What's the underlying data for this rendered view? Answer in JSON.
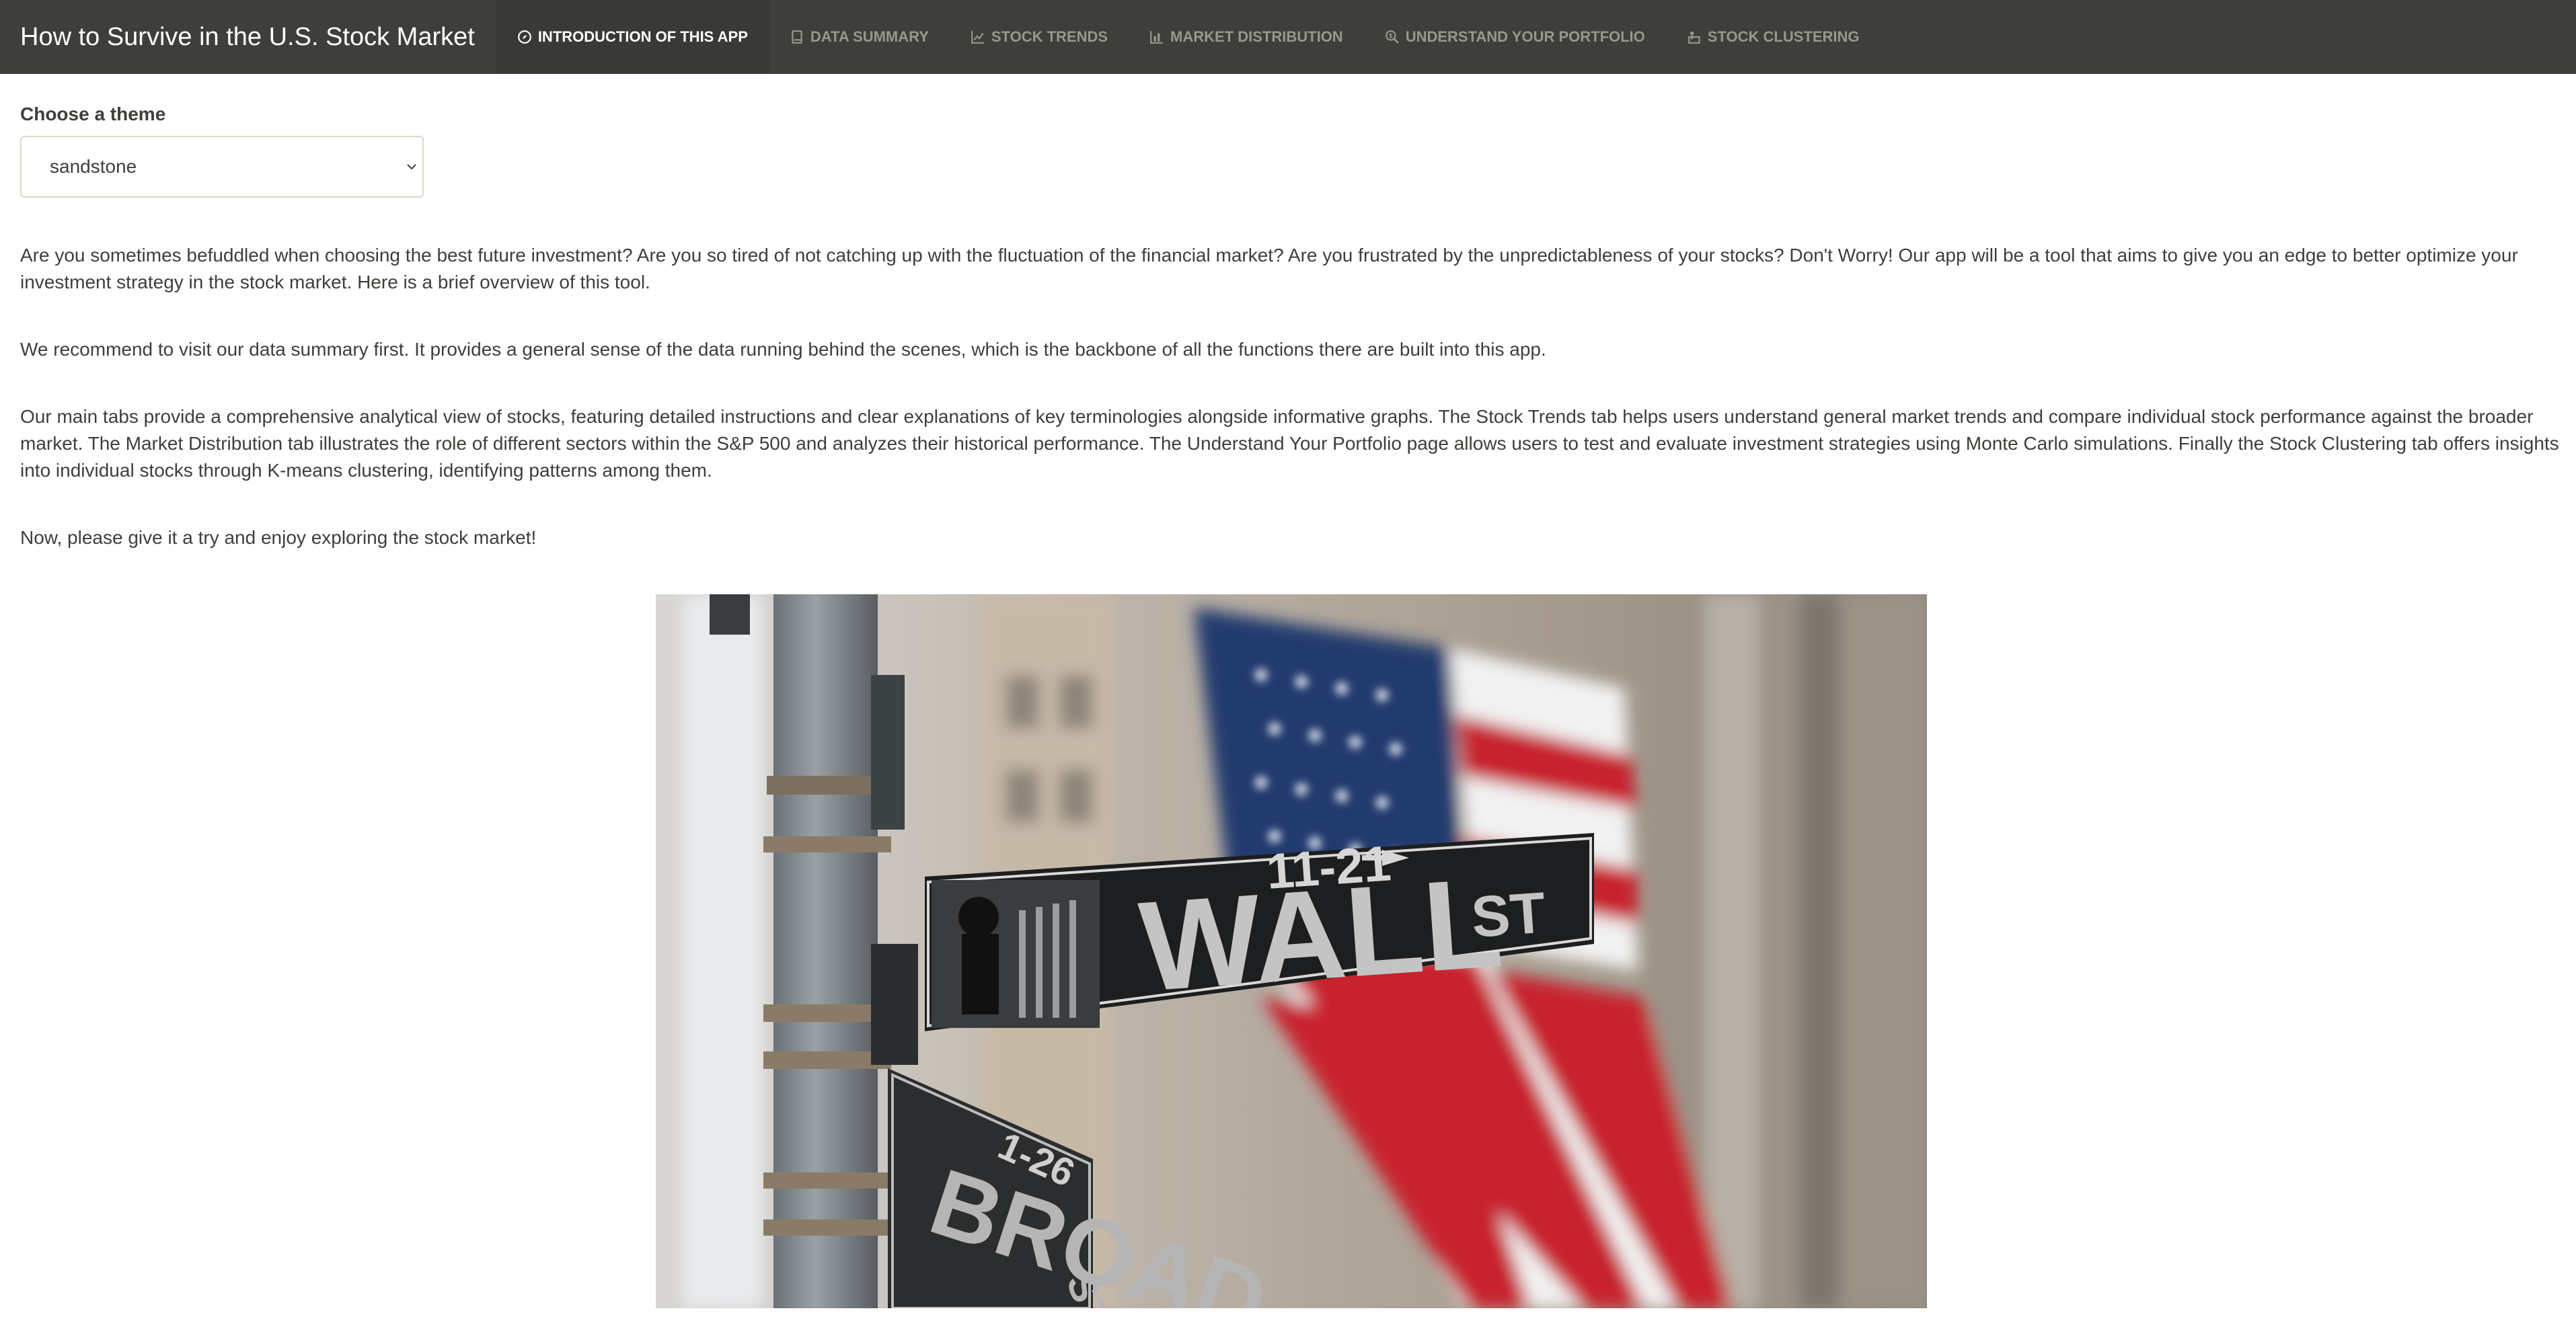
{
  "app": {
    "title": "How to Survive in the U.S. Stock Market"
  },
  "nav": {
    "tabs": [
      {
        "label": "Introduction of this app",
        "icon": "compass-icon",
        "active": true
      },
      {
        "label": "Data Summary",
        "icon": "book-icon",
        "active": false
      },
      {
        "label": "Stock Trends",
        "icon": "line-chart-icon",
        "active": false
      },
      {
        "label": "Market Distribution",
        "icon": "bar-chart-icon",
        "active": false
      },
      {
        "label": "Understand Your Portfolio",
        "icon": "magnifier-dollar-icon",
        "active": false
      },
      {
        "label": "Stock Clustering",
        "icon": "person-chalkboard-icon",
        "active": false
      }
    ]
  },
  "theme": {
    "label": "Choose a theme",
    "selected": "sandstone"
  },
  "intro": {
    "p1": "Are you sometimes befuddled when choosing the best future investment? Are you so tired of not catching up with the fluctuation of the financial market? Are you frustrated by the unpredictableness of your stocks? Don't Worry! Our app will be a tool that aims to give you an edge to better optimize your investment strategy in the stock market. Here is a brief overview of this tool.",
    "p2": "We recommend to visit our data summary first. It provides a general sense of the data running behind the scenes, which is the backbone of all the functions there are built into this app.",
    "p3": "Our main tabs provide a comprehensive analytical view of stocks, featuring detailed instructions and clear explanations of key terminologies alongside informative graphs. The Stock Trends tab helps users understand general market trends and compare individual stock performance against the broader market. The Market Distribution tab illustrates the role of different sectors within the S&P 500 and analyzes their historical performance. The Understand Your Portfolio page allows users to test and evaluate investment strategies using Monte Carlo simulations. Finally the Stock Clustering tab offers insights into individual stocks through K-means clustering, identifying patterns among them.",
    "p4": "Now, please give it a try and enjoy exploring the stock market!"
  },
  "hero_image": {
    "sign_top_number": "11-21",
    "sign_top_street": "WALL",
    "sign_top_suffix": "ST",
    "sign_bottom_number": "1-26",
    "sign_bottom_street": "BROAD",
    "sign_bottom_suffix": "ST"
  },
  "colors": {
    "navbar": "#3e3f3a",
    "nav_active": "#393a35",
    "nav_inactive_text": "#98978b",
    "text": "#3e3f3a",
    "select_border": "#dfd7ca"
  }
}
